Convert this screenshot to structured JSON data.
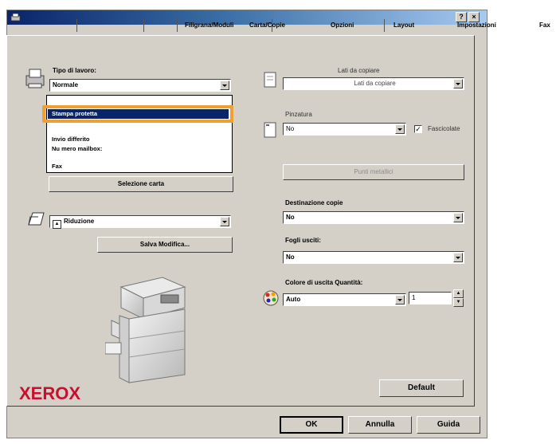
{
  "window": {
    "help_button": "?",
    "close_button": "×"
  },
  "tabs": [
    "Filigrana/Moduli",
    "Carta/Copie",
    "Opzioni",
    "Layout",
    "Impostazioni",
    "Fax"
  ],
  "left": {
    "job_type_label": "Tipo di lavoro:",
    "job_type_value": "Normale",
    "job_type_options": [
      "Stampa protetta",
      "Invio differito",
      "Nu mero mailbox:",
      "Fax"
    ],
    "paper_select_button": "Selezione carta",
    "reduction_value": "Riduzione",
    "save_button": "Salva Modifica..."
  },
  "right": {
    "sides_label": "Lati da copiare",
    "sides_value": "Lati da copiare",
    "stapling_label": "Pinzatura",
    "stapling_value": "No",
    "collate_label": "Fascicolate",
    "staple_points_button": "Punti metallici",
    "destination_label": "Destinazione copie",
    "destination_value": "No",
    "output_sheets_label": "Fogli usciti:",
    "output_sheets_value": "No",
    "color_qty_label": "Colore di uscita Quantità:",
    "color_value": "Auto",
    "quantity_value": "1",
    "default_button": "Default"
  },
  "brand": "XEROX",
  "footer": {
    "ok": "OK",
    "cancel": "Annulla",
    "help": "Guida"
  },
  "colors": {
    "highlight": "#0a246a",
    "callout": "#f0a030",
    "brand": "#c8102e"
  }
}
